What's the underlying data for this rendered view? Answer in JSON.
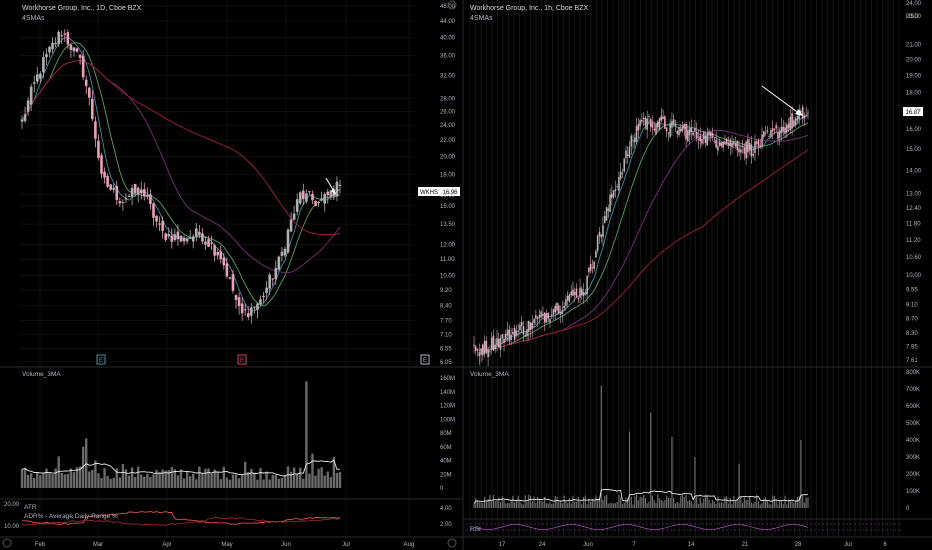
{
  "colors": {
    "background": "#000000",
    "grid": "#1c1c1c",
    "axis_text": "#b2b5be",
    "candle_up": "#b0b0b0",
    "candle_down": "#e8a0b8",
    "sma_cyan": "#3f8fa0",
    "sma_green": "#5aa060",
    "sma_purple": "#7a2f7a",
    "sma_red": "#a01f3a",
    "volume_bar": "#6a6a6a",
    "volume_avg": "#e8e8e8",
    "atr_line": "#e05050",
    "rsi_band": "#9040a0"
  },
  "left_chart": {
    "title": "Workhorse Group, Inc., 1D, Cboe BZX",
    "subtitle": "4SMAs",
    "symbol_tag": "WKHS",
    "last_price": "16.96",
    "event_markers": [
      "E",
      "E",
      "E"
    ],
    "price_ticks": [
      "48.00",
      "44.00",
      "40.00",
      "36.00",
      "32.00",
      "28.00",
      "26.00",
      "24.00",
      "22.00",
      "20.00",
      "18.00",
      "16.00",
      "15.00",
      "13.50",
      "12.00",
      "11.00",
      "10.00",
      "9.20",
      "8.40",
      "7.70",
      "7.10",
      "6.55",
      "6.05"
    ],
    "volume_label": "Volume_3MA",
    "volume_ticks": [
      "160M",
      "140M",
      "120M",
      "100M",
      "80M",
      "60M",
      "40M",
      "20M",
      "0"
    ],
    "atr_label": "ATR",
    "adr_label": "ADR% - Average Daily Range %",
    "atr_top_left": "20.00",
    "atr_left_ticks": [
      "10.00"
    ],
    "atr_right_ticks": [
      "4.00",
      "2.00"
    ],
    "time_ticks": [
      "Feb",
      "Mar",
      "Apr",
      "May",
      "Jun",
      "Jul",
      "Aug"
    ]
  },
  "right_chart": {
    "title": "Workhorse Group, Inc., 1h, Cboe BZX",
    "subtitle": "4SMAs",
    "currency": "USD",
    "last_price": "16.87",
    "price_ticks": [
      "24.00",
      "23.00",
      "21.00",
      "20.00",
      "19.00",
      "18.00",
      "17.00",
      "16.00",
      "15.00",
      "14.00",
      "13.00",
      "12.40",
      "11.80",
      "11.20",
      "10.60",
      "10.00",
      "9.55",
      "9.10",
      "8.70",
      "8.30",
      "7.95",
      "7.61"
    ],
    "volume_label": "Volume_3MA",
    "volume_ticks": [
      "800K",
      "700K",
      "600K",
      "500K",
      "400K",
      "300K",
      "200K",
      "100K",
      "0"
    ],
    "rsi_label": "RSI",
    "time_ticks": [
      "17",
      "24",
      "Jun",
      "7",
      "14",
      "21",
      "28",
      "Jul",
      "6"
    ]
  },
  "chart_data": [
    {
      "type": "candlestick",
      "title": "Workhorse Group, Inc., 1D, Cboe BZX",
      "x_label": "",
      "y_label": "",
      "y_scale": "log",
      "ylim": [
        6.05,
        48
      ],
      "x_ticks": [
        "Feb",
        "Mar",
        "Apr",
        "May",
        "Jun",
        "Jul",
        "Aug"
      ],
      "approx_close_path": [
        {
          "period": "late Jan",
          "close": 24.5
        },
        {
          "period": "early Feb",
          "close": 34
        },
        {
          "period": "Feb peak",
          "close": 41.5
        },
        {
          "period": "mid Feb",
          "close": 34
        },
        {
          "period": "late Feb",
          "close": 17.5
        },
        {
          "period": "early Mar",
          "close": 15.5
        },
        {
          "period": "mid Mar",
          "close": 16.5
        },
        {
          "period": "late Mar",
          "close": 12.8
        },
        {
          "period": "early Apr",
          "close": 12.4
        },
        {
          "period": "mid Apr",
          "close": 12.8
        },
        {
          "period": "late Apr",
          "close": 11.2
        },
        {
          "period": "early May",
          "close": 7.9
        },
        {
          "period": "mid May",
          "close": 8.6
        },
        {
          "period": "late May",
          "close": 11.0
        },
        {
          "period": "early Jun",
          "close": 16.0
        },
        {
          "period": "mid Jun",
          "close": 15.2
        },
        {
          "period": "late Jun",
          "close": 16.96
        }
      ],
      "last_price": 16.96
    },
    {
      "type": "bar",
      "title": "Volume_3MA",
      "y_unit": "shares",
      "ylim": [
        0,
        160000000
      ],
      "notable_spikes_millions": [
        46,
        60,
        72,
        40,
        155,
        50
      ],
      "typical_millions": [
        15,
        30
      ]
    },
    {
      "type": "candlestick",
      "title": "Workhorse Group, Inc., 1h, Cboe BZX",
      "y_scale": "log",
      "ylim": [
        7.61,
        24
      ],
      "x_ticks": [
        "17",
        "24",
        "Jun",
        "7",
        "14",
        "21",
        "28",
        "Jul",
        "6"
      ],
      "approx_close_path": [
        {
          "period": "17",
          "close": 7.8
        },
        {
          "period": "24",
          "close": 8.5
        },
        {
          "period": "Jun",
          "close": 9.6
        },
        {
          "period": "7",
          "close": 16.5
        },
        {
          "period": "14",
          "close": 15.7
        },
        {
          "period": "21",
          "close": 15.0
        },
        {
          "period": "28",
          "close": 16.87
        }
      ],
      "last_price": 16.87
    },
    {
      "type": "bar",
      "title": "Volume_3MA",
      "y_unit": "shares",
      "ylim": [
        0,
        800000
      ],
      "notable_spikes_thousands": [
        720,
        560,
        450,
        420,
        400
      ]
    }
  ]
}
